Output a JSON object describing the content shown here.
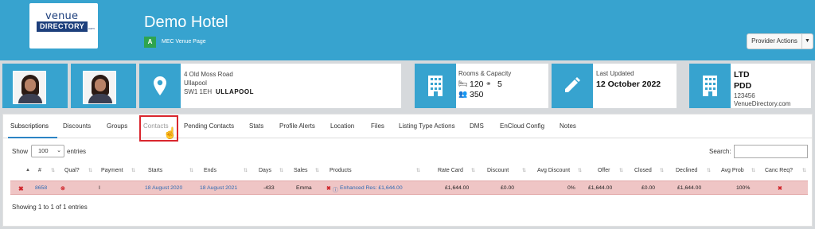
{
  "header": {
    "logo": {
      "venue": "venue",
      "directory": "DIRECTORY",
      "com": ".com"
    },
    "title": "Demo Hotel",
    "badge": "A",
    "subtitle": "MEC Venue Page",
    "provider_actions": "Provider Actions"
  },
  "cards": {
    "address": {
      "line1": "4 Old Moss Road",
      "line2": "Ullapool",
      "postcode": "SW1 1EH",
      "town": "ULLAPOOL"
    },
    "rooms": {
      "title": "Rooms & Capacity",
      "rooms": "120",
      "capacity": "5",
      "people": "350"
    },
    "updated": {
      "title": "Last Updated",
      "date": "12 October 2022"
    },
    "company": {
      "type": "LTD",
      "level": "PDD",
      "number": "123456",
      "site": "VenueDirectory.com"
    }
  },
  "tabs": [
    "Subscriptions",
    "Discounts",
    "Groups",
    "Contacts",
    "Pending Contacts",
    "Stats",
    "Profile Alerts",
    "Location",
    "Files",
    "Listing Type Actions",
    "DMS",
    "EnCloud Config",
    "Notes"
  ],
  "table_controls": {
    "show": "Show",
    "page_size": "100",
    "entries": "entries",
    "search": "Search:"
  },
  "table": {
    "headers": [
      "#",
      "Qual?",
      "Payment",
      "Starts",
      "Ends",
      "Days",
      "Sales",
      "Products",
      "Rate Card",
      "Discount",
      "Avg Discount",
      "Offer",
      "Closed",
      "Declined",
      "Avg Prob",
      "Canc Req?"
    ],
    "rows": [
      {
        "id": "8658",
        "payment": "I",
        "starts": "18 August 2020",
        "ends": "18 August 2021",
        "days": "-433",
        "sales": "Emma",
        "product": "Enhanced Res: £1,644.00",
        "rate_card": "£1,644.00",
        "discount": "£0.00",
        "avg_discount": "0%",
        "offer": "£1,644.00",
        "closed": "£0.00",
        "declined": "£1,644.00",
        "avg_prob": "100%"
      }
    ],
    "footer": "Showing 1 to 1 of 1 entries"
  }
}
